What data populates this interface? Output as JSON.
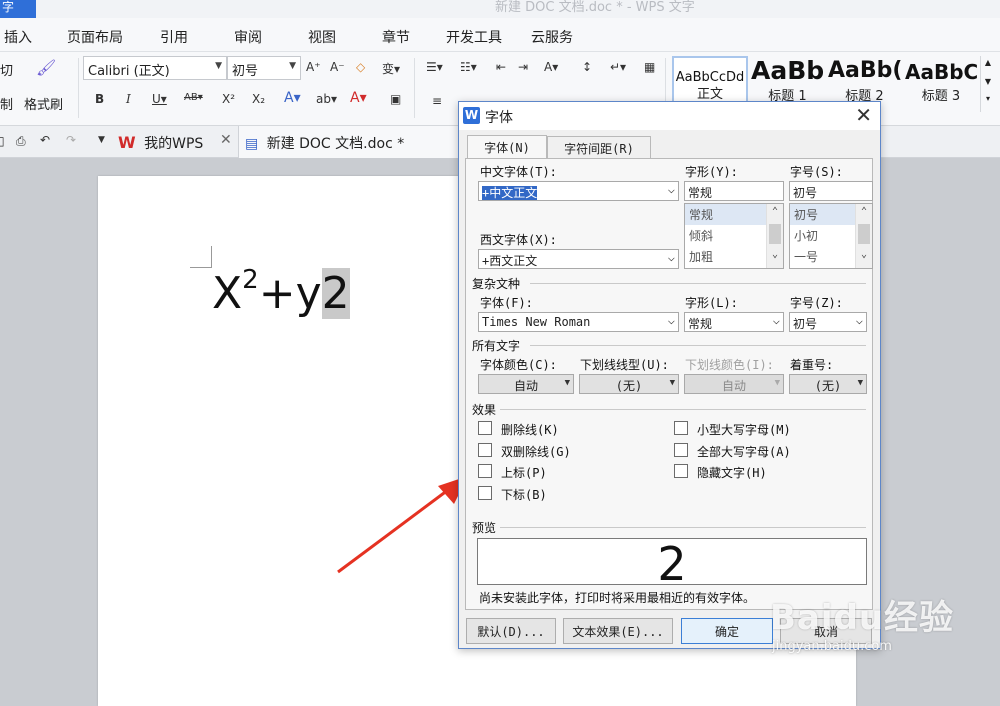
{
  "app": {
    "tab_label": "字",
    "window_title": "新建 DOC 文档.doc * - WPS 文字"
  },
  "menu": [
    {
      "label": "插入"
    },
    {
      "label": "页面布局"
    },
    {
      "label": "引用"
    },
    {
      "label": "审阅"
    },
    {
      "label": "视图"
    },
    {
      "label": "章节"
    },
    {
      "label": "开发工具"
    },
    {
      "label": "云服务"
    }
  ],
  "ribbon": {
    "cut_label": "切",
    "copy_label": "制",
    "format_painter_label": "格式刷",
    "font_name": "Calibri (正文)",
    "font_size": "初号",
    "styles": [
      {
        "sample": "AaBbCcDd",
        "name": "正文"
      },
      {
        "sample": "AaBb",
        "name": "标题 1"
      },
      {
        "sample": "AaBb(",
        "name": "标题 2"
      },
      {
        "sample": "AaBbC",
        "name": "标题 3"
      }
    ]
  },
  "tabs": {
    "my_wps": "我的WPS",
    "document": "新建 DOC 文档.doc *"
  },
  "document": {
    "base": "X",
    "superscript": "2",
    "middle": "+y",
    "selected": "2"
  },
  "font_dialog": {
    "title": "字体",
    "tabs": [
      "字体(N)",
      "字符间距(R)"
    ],
    "chinese_font_label": "中文字体(T):",
    "chinese_font_value": "+中文正文",
    "style_label": "字形(Y):",
    "style_value": "常规",
    "style_options": [
      "常规",
      "倾斜",
      "加粗"
    ],
    "size_label": "字号(S):",
    "size_value": "初号",
    "size_options": [
      "初号",
      "小初",
      "一号"
    ],
    "western_font_label": "西文字体(X):",
    "western_font_value": "+西文正文",
    "complex_section": "复杂文种",
    "complex_font_label": "字体(F):",
    "complex_font_value": "Times New Roman",
    "complex_style_label": "字形(L):",
    "complex_style_value": "常规",
    "complex_size_label": "字号(Z):",
    "complex_size_value": "初号",
    "all_text_section": "所有文字",
    "font_color_label": "字体颜色(C):",
    "font_color_value": "自动",
    "underline_type_label": "下划线线型(U):",
    "underline_type_value": "(无)",
    "underline_color_label": "下划线颜色(I):",
    "underline_color_value": "自动",
    "emphasis_label": "着重号:",
    "emphasis_value": "(无)",
    "effects_section": "效果",
    "effects": {
      "strikethrough": "删除线(K)",
      "double_strikethrough": "双删除线(G)",
      "superscript": "上标(P)",
      "subscript": "下标(B)",
      "small_caps": "小型大写字母(M)",
      "all_caps": "全部大写字母(A)",
      "hidden": "隐藏文字(H)"
    },
    "preview_section": "预览",
    "preview_text": "2",
    "preview_note": "尚未安装此字体，打印时将采用最相近的有效字体。",
    "buttons": {
      "default": "默认(D)...",
      "text_effects": "文本效果(E)...",
      "ok": "确定",
      "cancel": "取消"
    }
  },
  "watermark": {
    "main": "Baidu经验",
    "sub": "jingyan.baidu.com"
  },
  "colors": {
    "accent": "#2f6fd8",
    "arrow": "#e53222"
  }
}
